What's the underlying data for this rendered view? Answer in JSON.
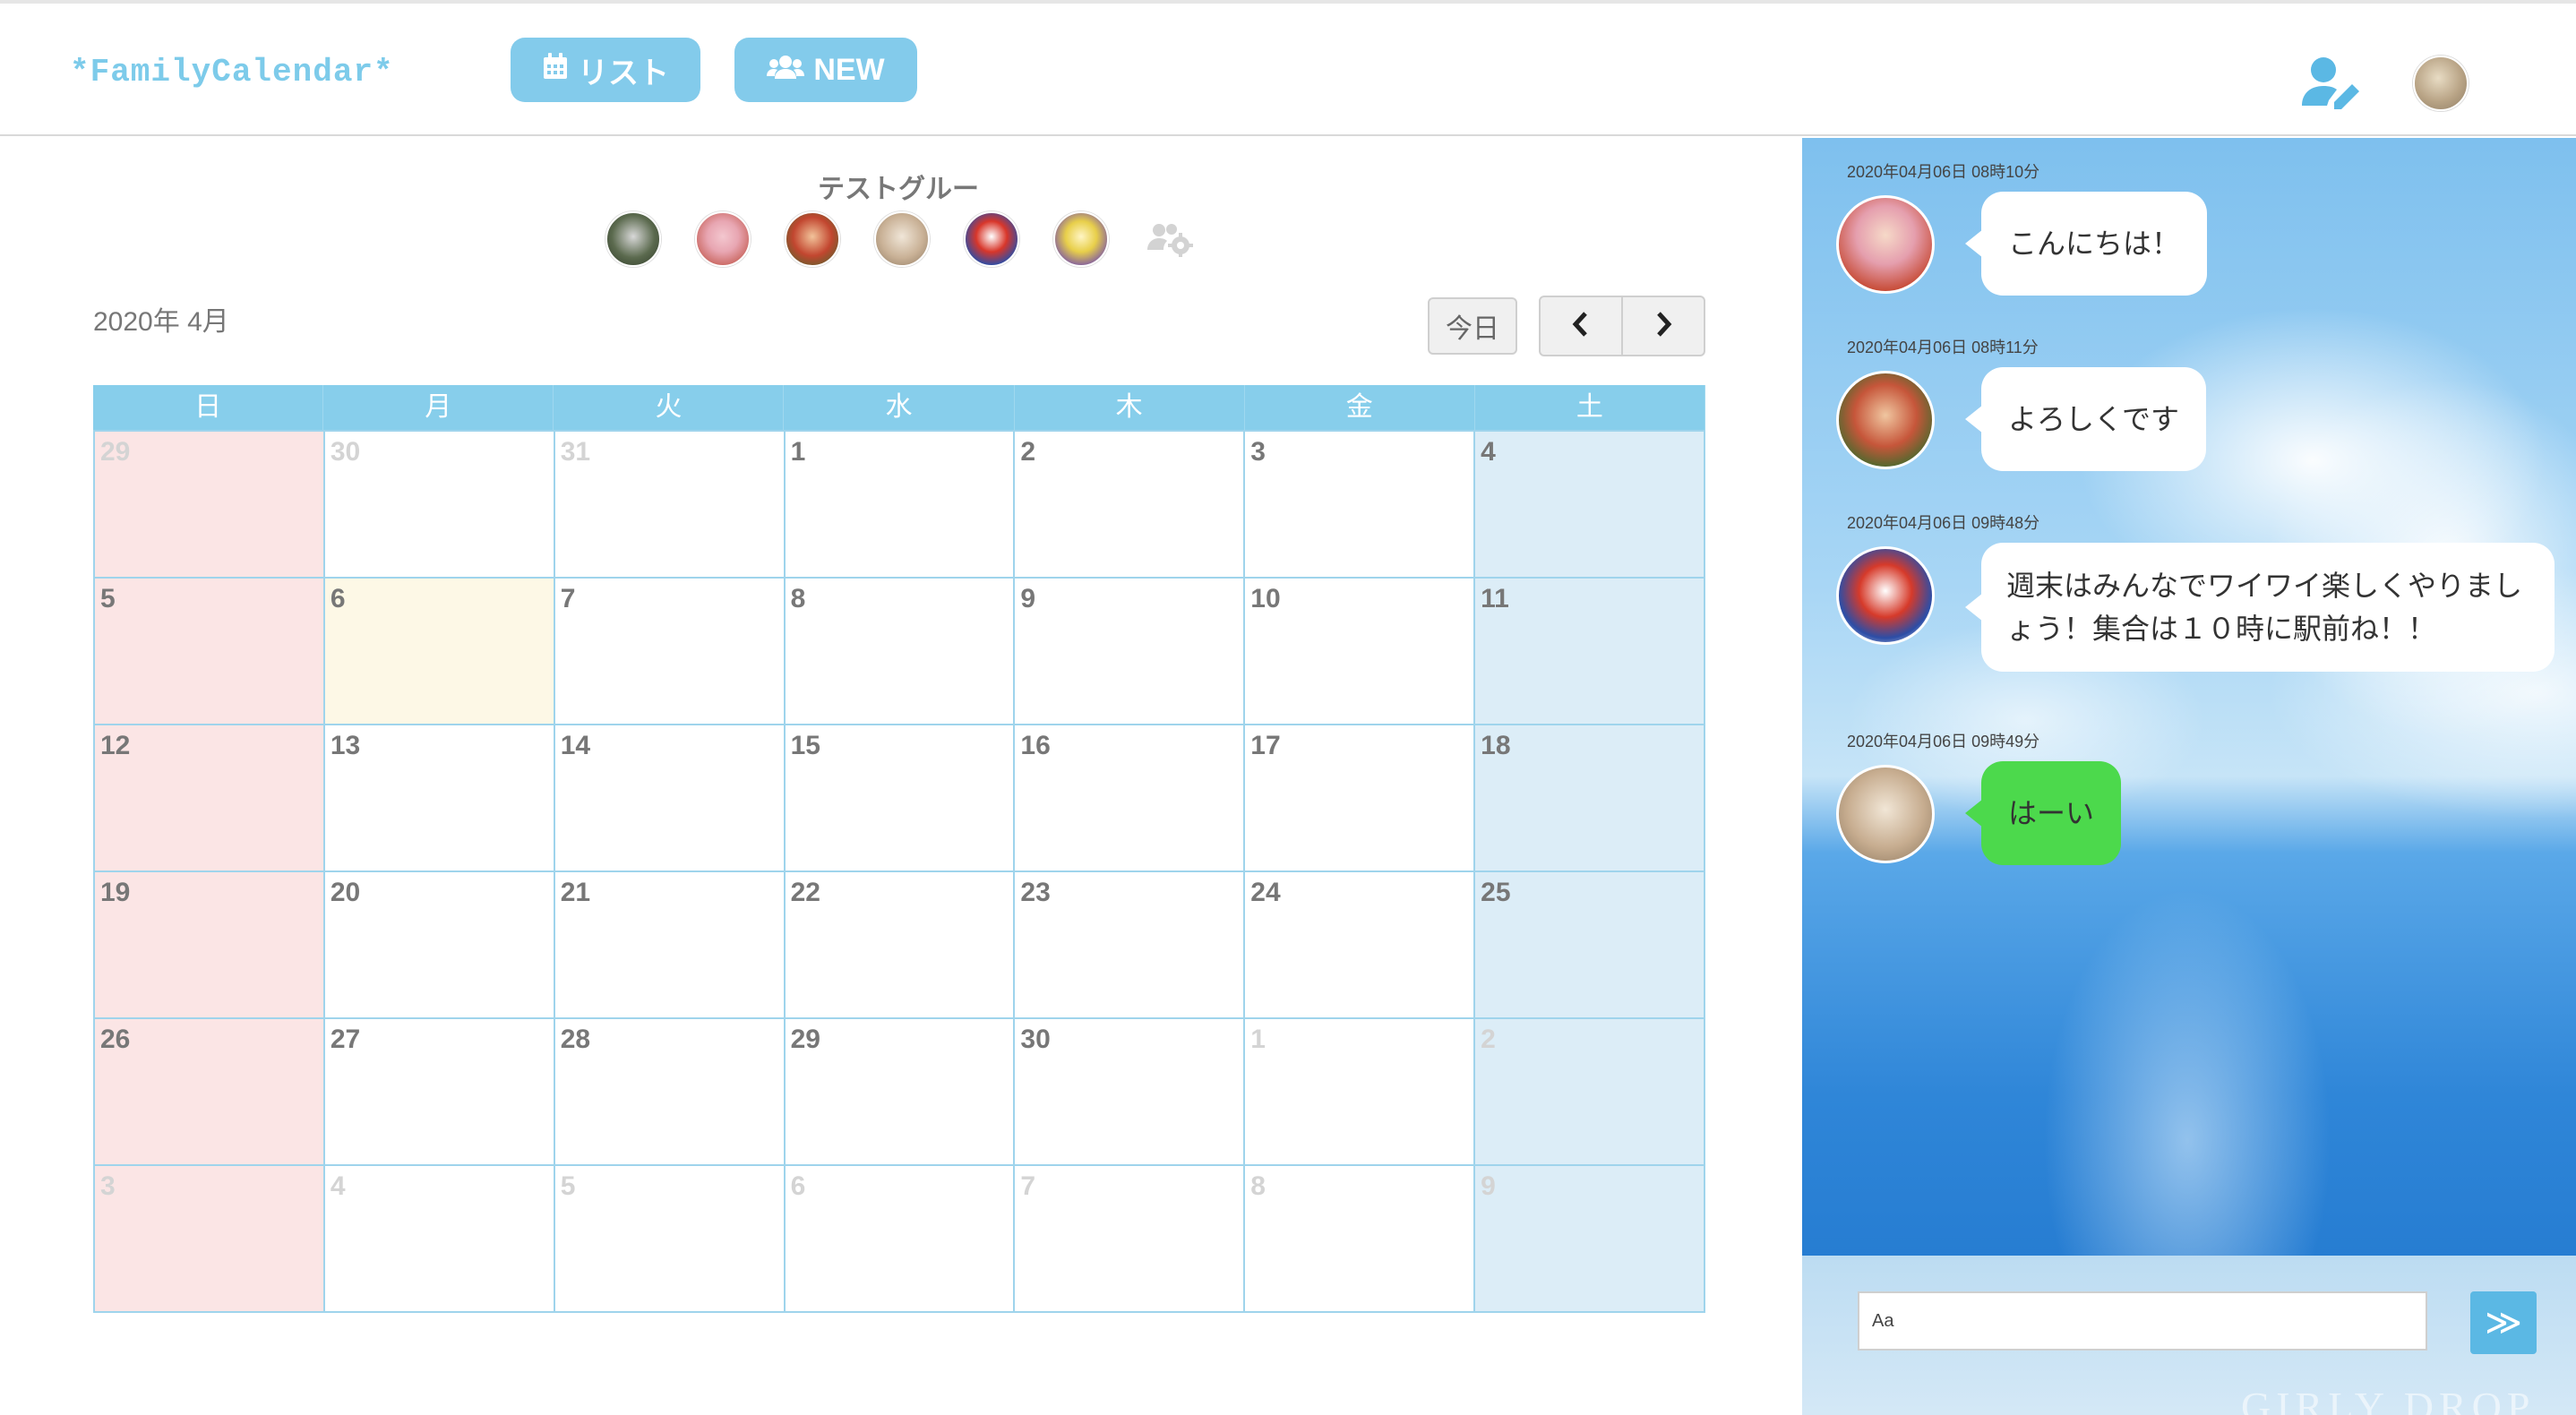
{
  "app": {
    "logo": "*FamilyCalendar*"
  },
  "header": {
    "list_label": "リスト",
    "new_label": "NEW",
    "icons": {
      "list": "calendar-icon",
      "new": "users-icon",
      "profile_edit": "user-edit-icon",
      "avatar": "user-avatar"
    }
  },
  "group": {
    "name": "テストグループ",
    "member_count": 6,
    "settings_icon": "users-cog-icon"
  },
  "calendar": {
    "month_label": "2020年 4月",
    "today_label": "今日",
    "weekdays": [
      "日",
      "月",
      "火",
      "水",
      "木",
      "金",
      "土"
    ],
    "days": [
      "29",
      "30",
      "31",
      "1",
      "2",
      "3",
      "4",
      "5",
      "6",
      "7",
      "8",
      "9",
      "10",
      "11",
      "12",
      "13",
      "14",
      "15",
      "16",
      "17",
      "18",
      "19",
      "20",
      "21",
      "22",
      "23",
      "24",
      "25",
      "26",
      "27",
      "28",
      "29",
      "30",
      "1",
      "2",
      "3",
      "4",
      "5",
      "6",
      "7",
      "8",
      "9"
    ],
    "today_day": "6"
  },
  "chat": {
    "messages": [
      {
        "time": "2020年04月06日 08時10分",
        "text": "こんにちは！"
      },
      {
        "time": "2020年04月06日 08時11分",
        "text": "よろしくです"
      },
      {
        "time": "2020年04月06日 09時48分",
        "text": "週末はみんなでワイワイ楽しくやりましょう！集合は１０時に駅前ね！！"
      },
      {
        "time": "2020年04月06日 09時49分",
        "text": "はーい"
      }
    ],
    "input_placeholder": "Aa",
    "send_label": "≫",
    "watermark": "GIRLY DROP"
  },
  "colors": {
    "accent": "#83cbeb",
    "sunday_bg": "#fbe5e5",
    "saturday_bg": "#dcedf7",
    "today_bg": "#fdf8e6",
    "own_bubble": "#4cd94c"
  }
}
